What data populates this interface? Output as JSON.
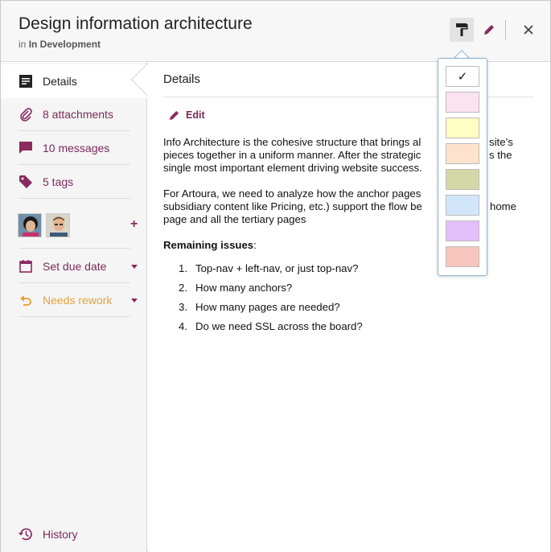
{
  "header": {
    "title": "Design information architecture",
    "subtitle_prefix": "in",
    "subtitle_project": "In Development"
  },
  "sidebar": {
    "items": [
      {
        "label": "Details",
        "icon": "details-icon",
        "active": true
      },
      {
        "label": "8 attachments",
        "icon": "paperclip-icon"
      },
      {
        "label": "10 messages",
        "icon": "message-icon"
      },
      {
        "label": "5 tags",
        "icon": "tag-icon"
      },
      {
        "label": "Set due date",
        "icon": "calendar-icon"
      },
      {
        "label": "Needs rework",
        "icon": "rework-icon"
      },
      {
        "label": "History",
        "icon": "history-icon"
      }
    ],
    "plus_label": "+"
  },
  "main": {
    "title": "Details",
    "edit_label": "Edit",
    "para1_lines": [
      "Info Architecture is the cohesive structure that brings al",
      "pieces together in a uniform manner. After the strategic",
      "single most important element driving website success."
    ],
    "para1_tail": [
      "site’s",
      "s the",
      ""
    ],
    "para2_lines": [
      "For Artoura, we need to analyze how the anchor pages",
      "subsidiary content like Pricing, etc.) support the flow be",
      "page and all the tertiary pages"
    ],
    "para2_tail": [
      "",
      "home",
      ""
    ],
    "issues_title": "Remaining issues",
    "issues_colon": ":",
    "issues": [
      {
        "n": "1.",
        "text": "Top-nav + left-nav, or just top-nav?"
      },
      {
        "n": "2.",
        "text": "How many anchors?"
      },
      {
        "n": "3.",
        "text": "How many pages are needed?"
      },
      {
        "n": "4.",
        "text": "Do we need SSL across the board?"
      }
    ]
  },
  "popover": {
    "check": "✓",
    "swatches": [
      "#ffffff",
      "#fbe3f0",
      "#ffffc4",
      "#fde3cd",
      "#d3d8a6",
      "#d2e6fb",
      "#e4bff9",
      "#f8c6bc"
    ]
  },
  "colors": {
    "accent": "#7a2a5a",
    "rework": "#e8a23a"
  }
}
